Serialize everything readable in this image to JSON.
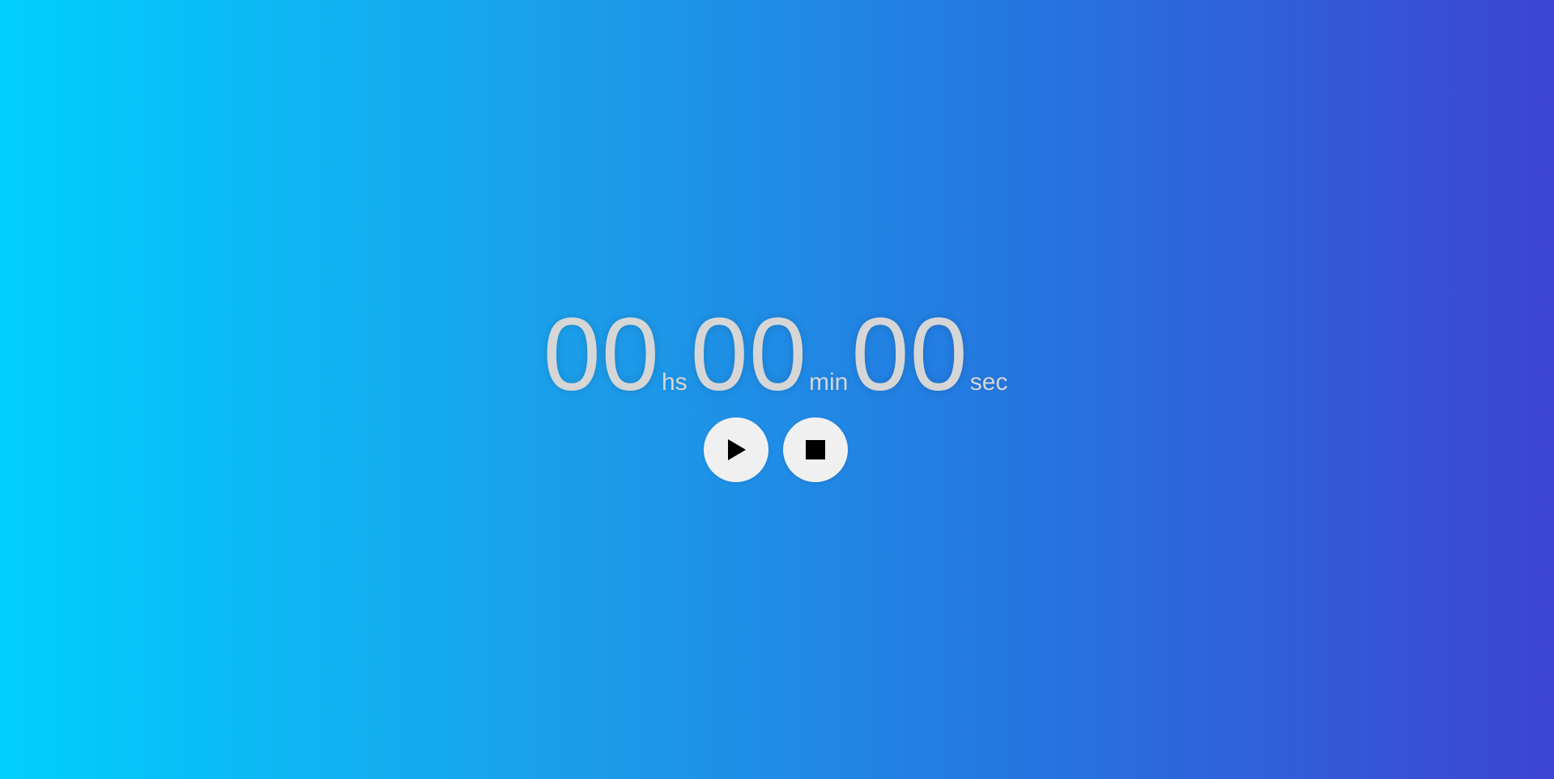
{
  "timer": {
    "hours": "00",
    "hours_unit": "hs",
    "minutes": "00",
    "minutes_unit": "min",
    "seconds": "00",
    "seconds_unit": "sec"
  },
  "controls": {
    "play_icon": "play-icon",
    "stop_icon": "stop-icon"
  },
  "colors": {
    "gradient_start": "#00cfff",
    "gradient_end": "#3d44d3",
    "digit_color": "#d6d6d6",
    "button_bg": "#f0f0f0",
    "icon_color": "#000000"
  }
}
